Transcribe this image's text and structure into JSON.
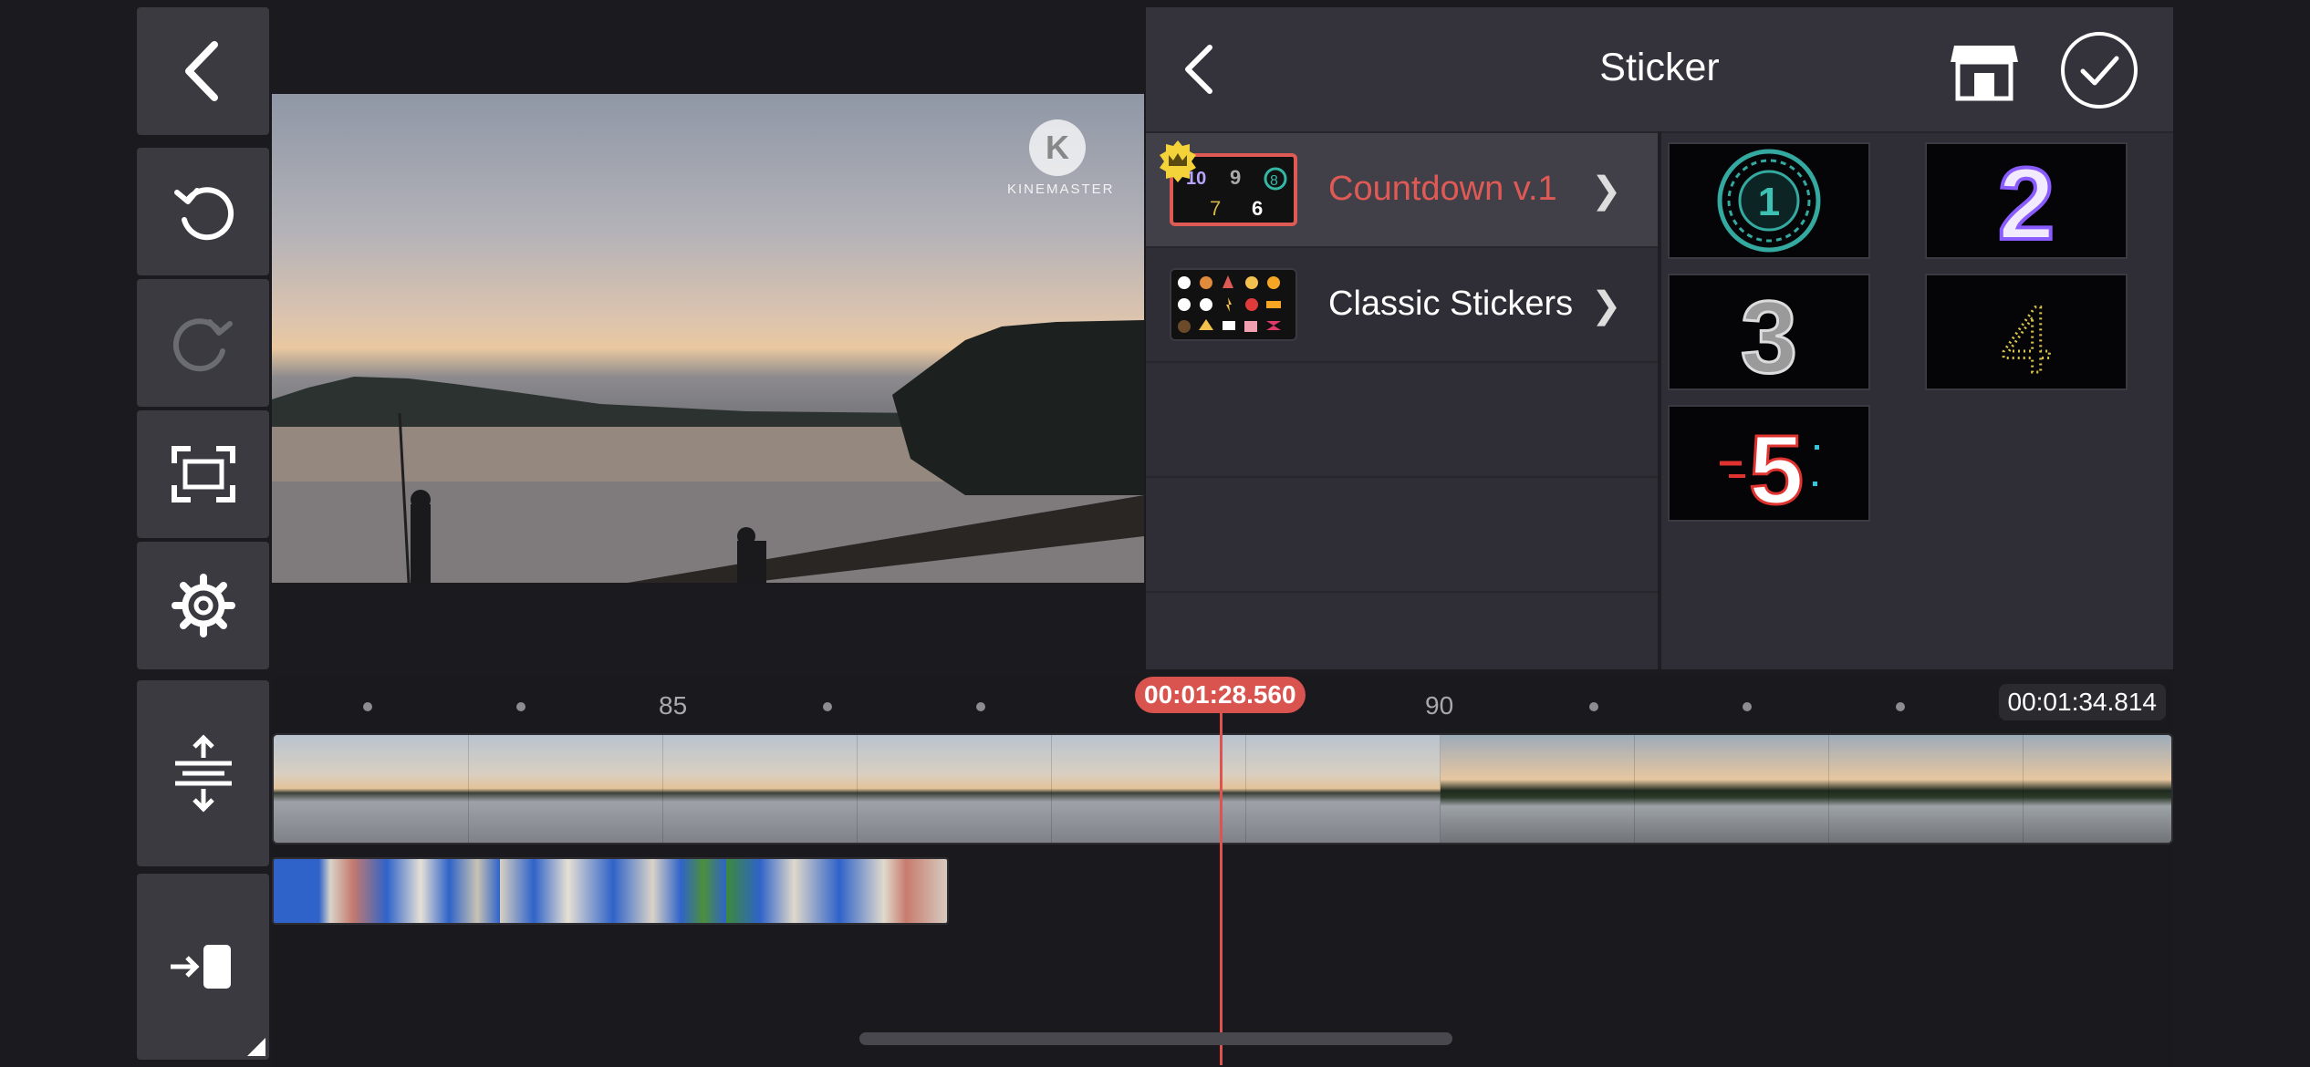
{
  "toolbar": {
    "back": "back-arrow-icon",
    "undo": "undo-icon",
    "redo": "redo-icon",
    "fullscreen": "fullscreen-icon",
    "settings": "gear-icon",
    "track_expand": "expand-tracks-icon",
    "jump_to_start": "jump-to-start-icon"
  },
  "preview": {
    "watermark_letter": "K",
    "watermark_text": "KINEMASTER"
  },
  "sticker_panel": {
    "title": "Sticker",
    "categories": [
      {
        "label": "Countdown v.1",
        "selected": true,
        "premium": true,
        "thumb_glyphs": [
          "10",
          "9",
          "8",
          "7",
          "6"
        ]
      },
      {
        "label": "Classic Stickers",
        "selected": false,
        "premium": false
      }
    ],
    "stickers": [
      {
        "name": "countdown-1",
        "glyph": "1"
      },
      {
        "name": "countdown-2",
        "glyph": "2"
      },
      {
        "name": "countdown-3",
        "glyph": "3"
      },
      {
        "name": "countdown-4",
        "glyph": "4"
      },
      {
        "name": "countdown-5",
        "glyph": "5"
      }
    ],
    "accent_color": "#e05a55"
  },
  "timeline": {
    "playhead_time": "00:01:28.560",
    "end_time": "00:01:34.814",
    "tick_labels": [
      "85",
      "90"
    ]
  }
}
